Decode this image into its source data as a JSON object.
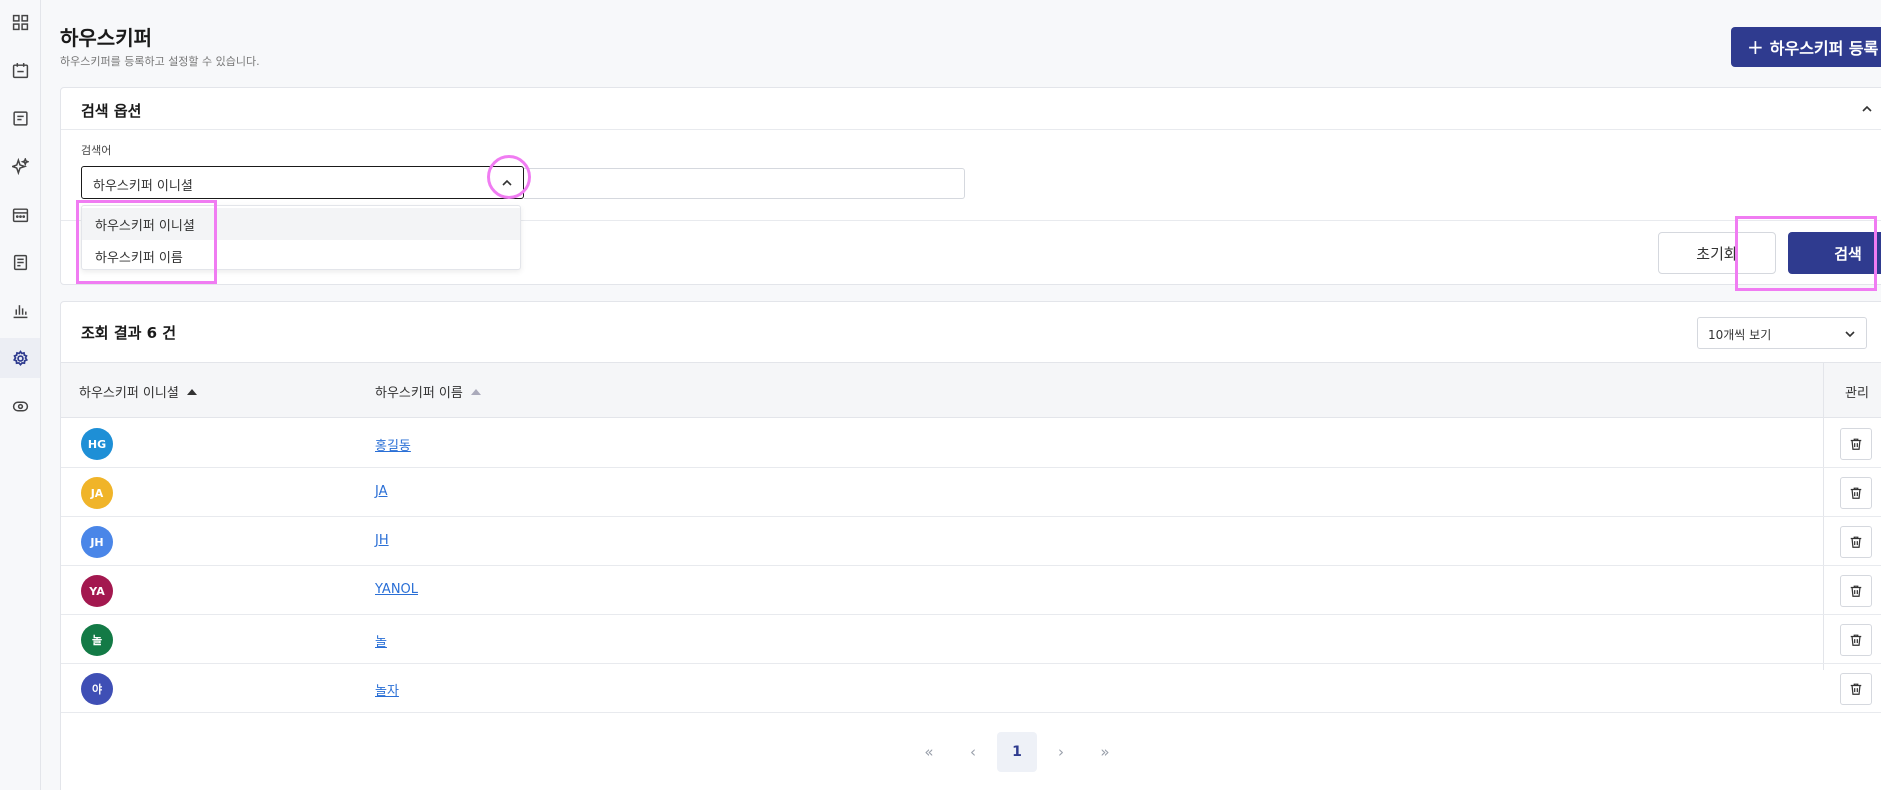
{
  "sidebar": {
    "items": [
      {
        "icon": "dashboard-grid-icon"
      },
      {
        "icon": "calendar-icon"
      },
      {
        "icon": "document-icon"
      },
      {
        "icon": "sparkle-icon"
      },
      {
        "icon": "schedule-icon"
      },
      {
        "icon": "checklist-icon"
      },
      {
        "icon": "bar-chart-icon"
      },
      {
        "icon": "gear-icon",
        "active": true
      },
      {
        "icon": "eye-icon"
      }
    ]
  },
  "header": {
    "title": "하우스키퍼",
    "subtitle": "하우스키퍼를 등록하고 설정할 수 있습니다.",
    "add_button": {
      "plus": "+",
      "label": "하우스키퍼 등록"
    }
  },
  "search": {
    "title": "검색 옵션",
    "field_label": "검색어",
    "select_value": "하우스키퍼 이니셜",
    "options": [
      "하우스키퍼 이니셜",
      "하우스키퍼 이름"
    ],
    "input_value": "",
    "reset_label": "초기화",
    "search_label": "검색"
  },
  "results": {
    "title": "조회 결과 6 건",
    "page_size": "10개씩 보기",
    "columns": [
      "하우스키퍼 이니셜",
      "하우스키퍼 이름",
      "관리"
    ],
    "rows": [
      {
        "initial": "HG",
        "name": "홍길동",
        "color": "#1e8fd6"
      },
      {
        "initial": "JA",
        "name": "JA",
        "color": "#f0b429"
      },
      {
        "initial": "JH",
        "name": "JH",
        "color": "#4a86e8"
      },
      {
        "initial": "YA",
        "name": "YANOL",
        "color": "#a3184f"
      },
      {
        "initial": "놀",
        "name": "놀",
        "color": "#137a46"
      },
      {
        "initial": "야",
        "name": "놀자",
        "color": "#3f4fb5"
      }
    ],
    "pagination": {
      "first": "«",
      "prev": "‹",
      "current": "1",
      "next": "›",
      "last": "»"
    }
  },
  "colors": {
    "primary": "#2f3b8f",
    "link": "#2a6fd6",
    "highlight": "#f07cf2"
  }
}
